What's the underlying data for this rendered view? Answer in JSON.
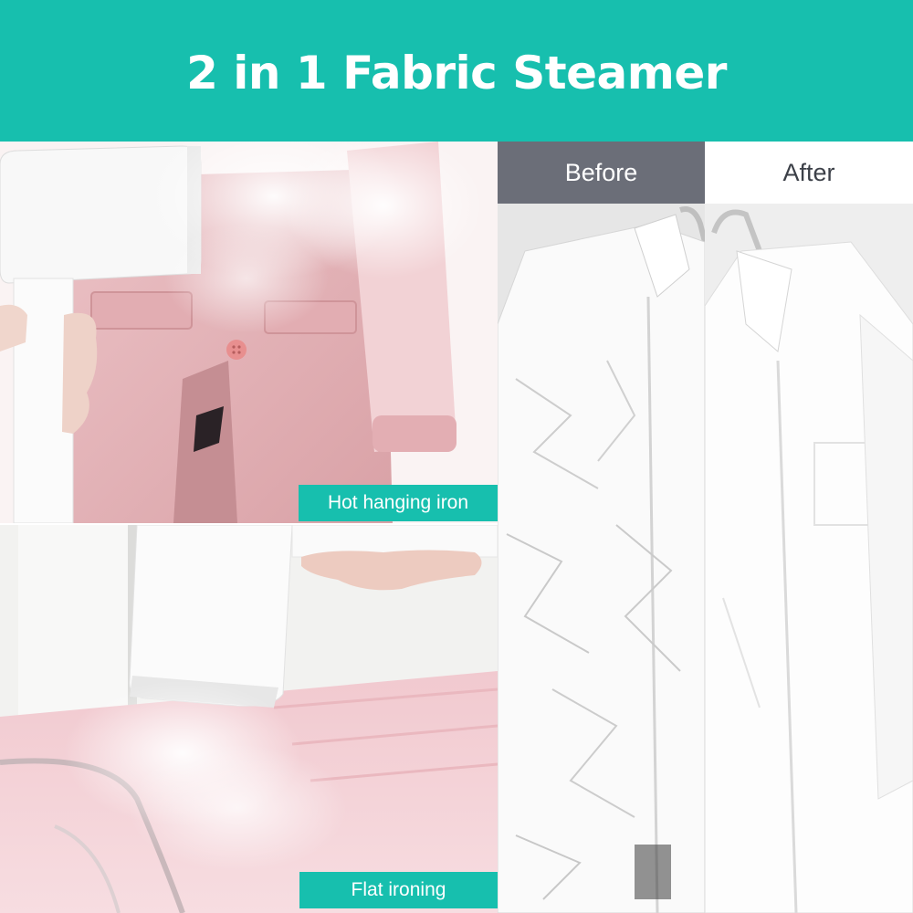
{
  "header": {
    "title": "2 in 1 Fabric Steamer"
  },
  "panels": {
    "hanging": {
      "label": "Hot hanging iron",
      "image": "steamer-on-pink-coat-image"
    },
    "flat": {
      "label": "Flat ironing",
      "image": "steamer-on-pink-fabric-image"
    },
    "before": {
      "label": "Before",
      "image": "wrinkled-white-shirt-image"
    },
    "after": {
      "label": "After",
      "image": "smooth-white-shirt-image"
    }
  },
  "colors": {
    "accent": "#17bfae",
    "before_header": "#6b6e78",
    "after_header_text": "#3c4048",
    "coat_pink": "#e7b9bd"
  }
}
